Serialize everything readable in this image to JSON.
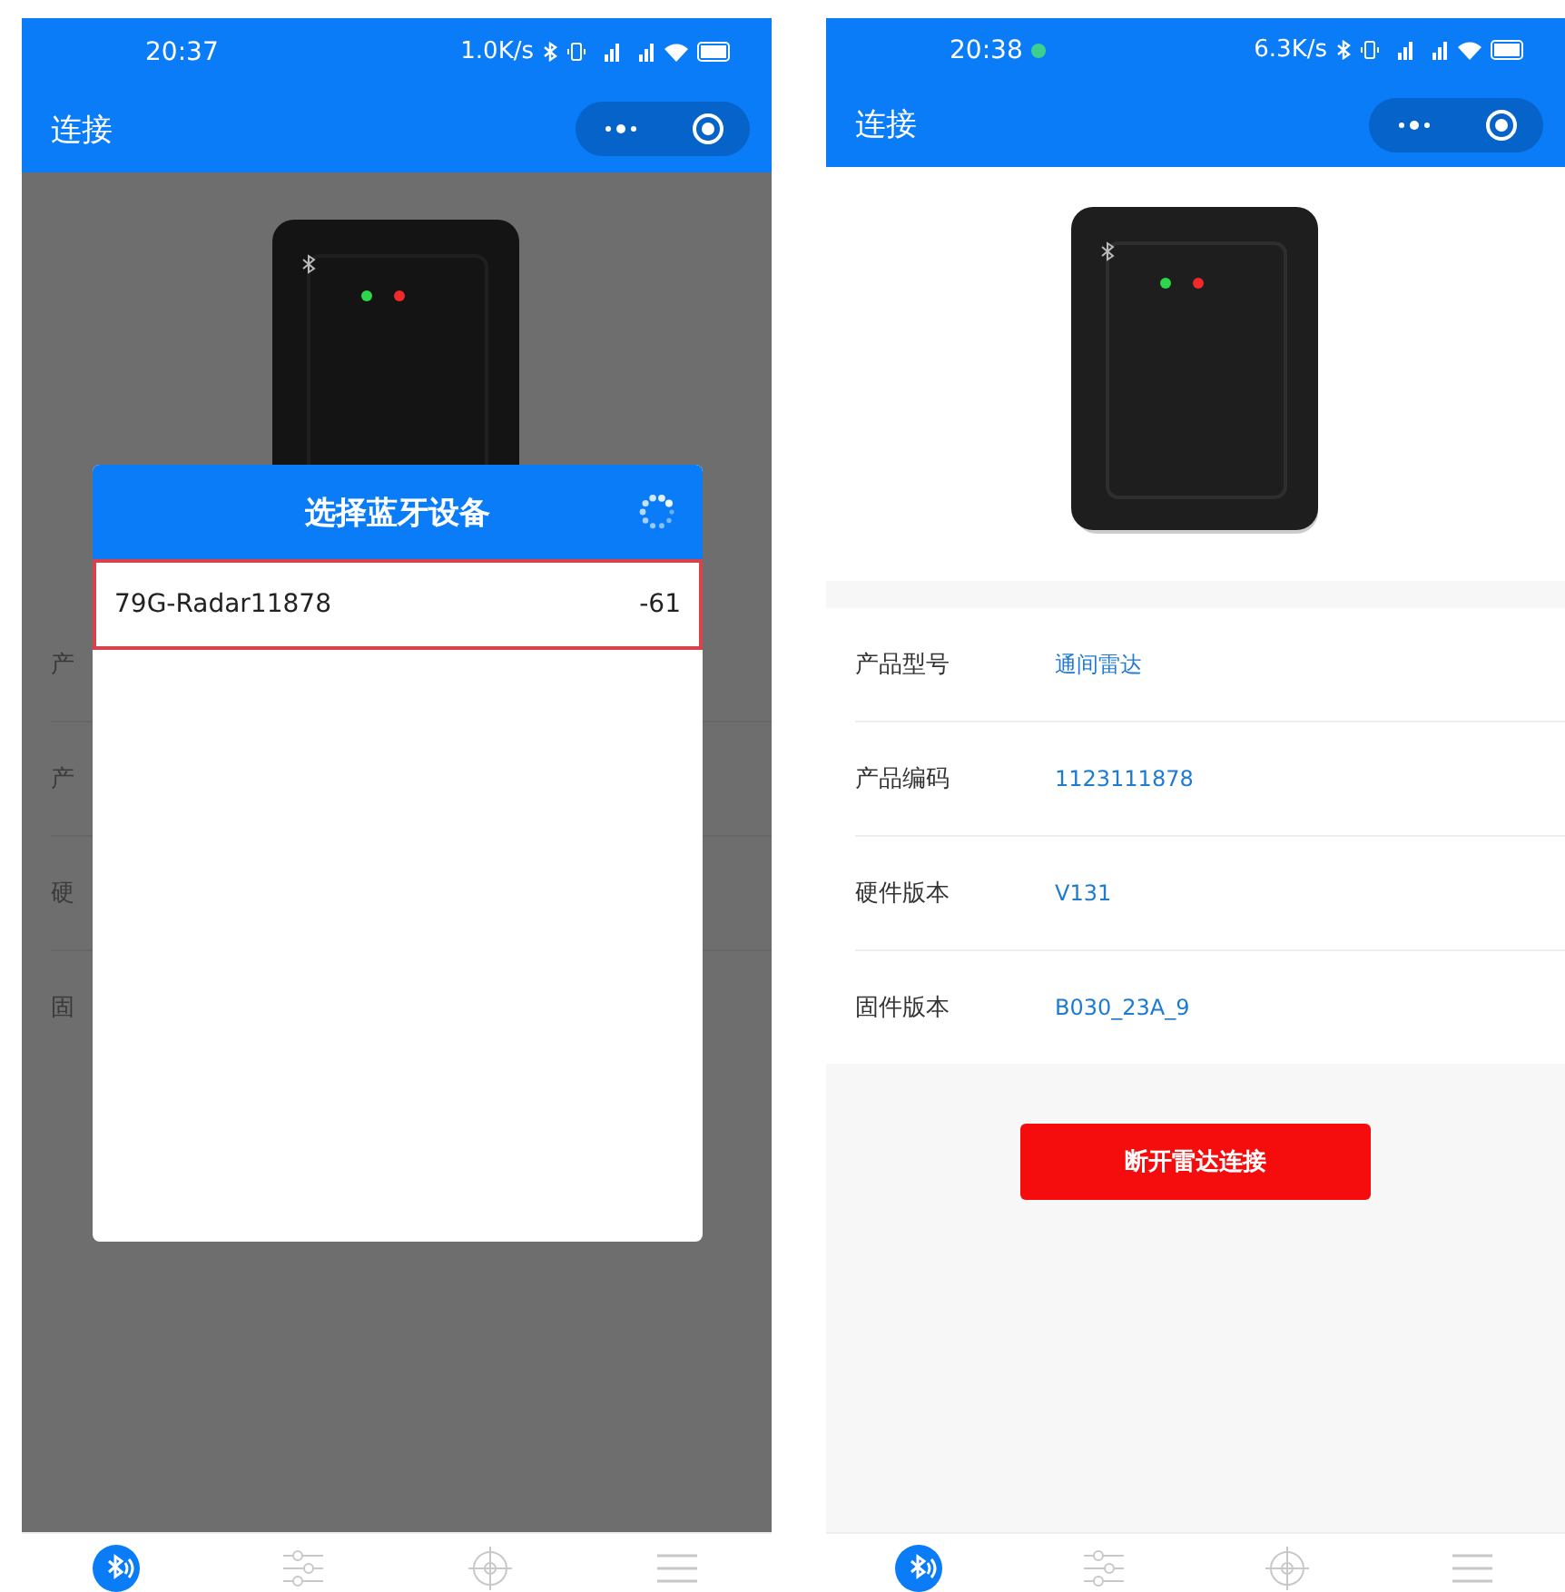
{
  "left_screen": {
    "status_bar": {
      "time": "20:37",
      "speed": "1.0K/s"
    },
    "nav_title": "连接",
    "dimmed": true,
    "info_rows": [
      {
        "label": "产"
      },
      {
        "label": "产"
      },
      {
        "label": "硬"
      },
      {
        "label": "固"
      }
    ],
    "dialog": {
      "title": "选择蓝牙设备",
      "loading": true,
      "devices": [
        {
          "name": "79G-Radar11878",
          "rssi": "-61",
          "selected": true
        }
      ]
    },
    "tabs": [
      {
        "selected": true
      },
      {
        "selected": false
      },
      {
        "selected": false
      },
      {
        "selected": false
      }
    ]
  },
  "right_screen": {
    "status_bar": {
      "time": "20:38",
      "notification_dot": true,
      "speed": "6.3K/s"
    },
    "nav_title": "连接",
    "info_rows": [
      {
        "label": "产品型号",
        "value": "通间雷达"
      },
      {
        "label": "产品编码",
        "value": "1123111878"
      },
      {
        "label": "硬件版本",
        "value": "V131"
      },
      {
        "label": "固件版本",
        "value": "B030_23A_9"
      }
    ],
    "disconnect_button": "断开雷达连接",
    "tabs": [
      {
        "selected": true
      },
      {
        "selected": false
      },
      {
        "selected": false
      },
      {
        "selected": false
      }
    ]
  }
}
